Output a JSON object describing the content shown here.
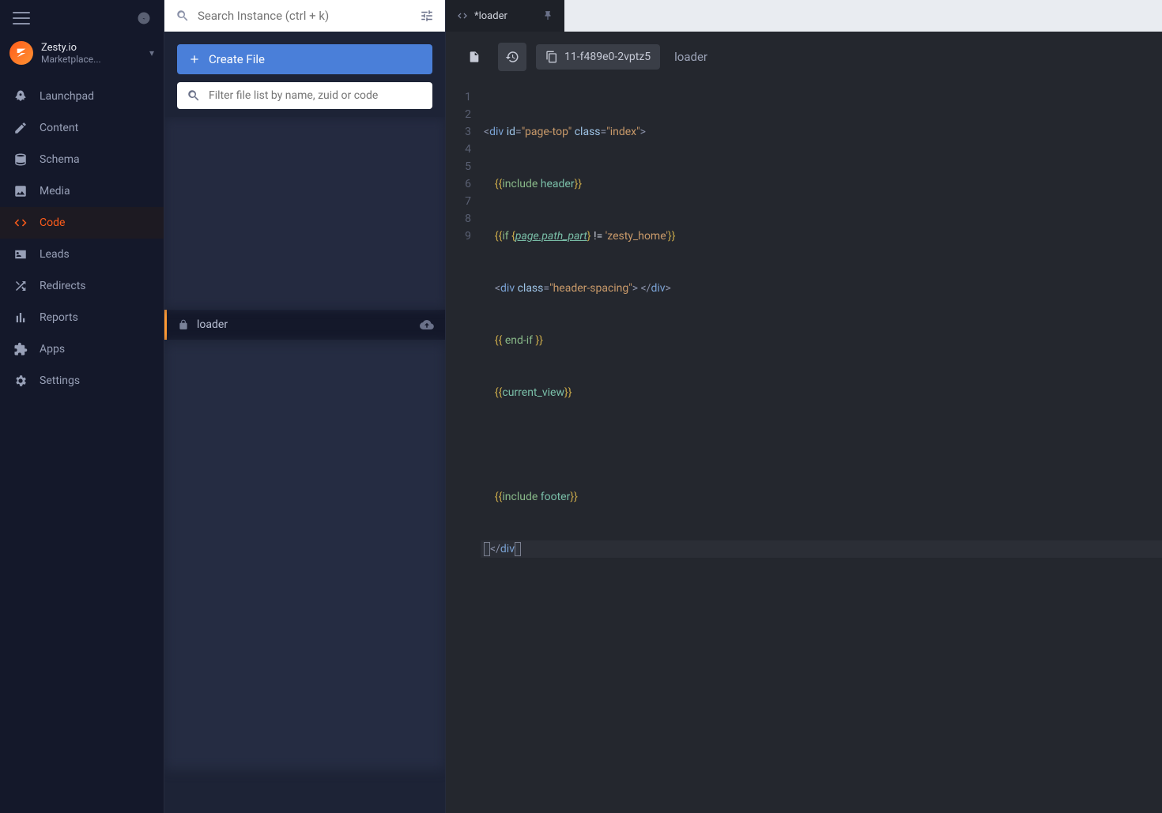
{
  "brand": {
    "name": "Zesty.io",
    "instance": "Marketplace..."
  },
  "search": {
    "placeholder": "Search Instance (ctrl + k)"
  },
  "sidebar": {
    "items": [
      {
        "label": "Launchpad",
        "icon": "rocket"
      },
      {
        "label": "Content",
        "icon": "pencil"
      },
      {
        "label": "Schema",
        "icon": "database"
      },
      {
        "label": "Media",
        "icon": "image"
      },
      {
        "label": "Code",
        "icon": "code"
      },
      {
        "label": "Leads",
        "icon": "id"
      },
      {
        "label": "Redirects",
        "icon": "shuffle"
      },
      {
        "label": "Reports",
        "icon": "bar"
      },
      {
        "label": "Apps",
        "icon": "puzzle"
      },
      {
        "label": "Settings",
        "icon": "gear"
      }
    ],
    "activeIndex": 4
  },
  "filepanel": {
    "create_label": "Create File",
    "filter_placeholder": "Filter file list by name, zuid or code",
    "active_file": "loader"
  },
  "tab": {
    "title": "*loader"
  },
  "toolbar": {
    "zuid": "11-f489e0-2vptz5",
    "filename": "loader"
  },
  "editor": {
    "lines": [
      1,
      2,
      3,
      4,
      5,
      6,
      7,
      8,
      9
    ],
    "code": {
      "l1": {
        "a": "<",
        "b": "div",
        "c": " id",
        "d": "=",
        "e": "\"page-top\"",
        "f": " class",
        "g": "=",
        "h": "\"index\"",
        "i": ">"
      },
      "l2": {
        "a": "{{",
        "b": "include",
        "c": " header",
        "d": "}}"
      },
      "l3": {
        "a": "{{",
        "b": "if",
        "c": " {",
        "d": "page.path_part",
        "e": "}",
        "f": " != ",
        "g": "'zesty_home'",
        "h": "}}"
      },
      "l4": {
        "a": "<",
        "b": "div",
        "c": " class",
        "d": "=",
        "e": "\"header-spacing\"",
        "f": "> </",
        "g": "div",
        "h": ">"
      },
      "l5": {
        "a": "{{ ",
        "b": "end-if",
        "c": " }}"
      },
      "l6": {
        "a": "{{",
        "b": "current_view",
        "c": "}}"
      },
      "l7": "",
      "l8": {
        "a": "{{",
        "b": "include",
        "c": " footer",
        "d": "}}"
      },
      "l9": {
        "a": "</",
        "b": "div",
        "c": ">"
      }
    }
  }
}
